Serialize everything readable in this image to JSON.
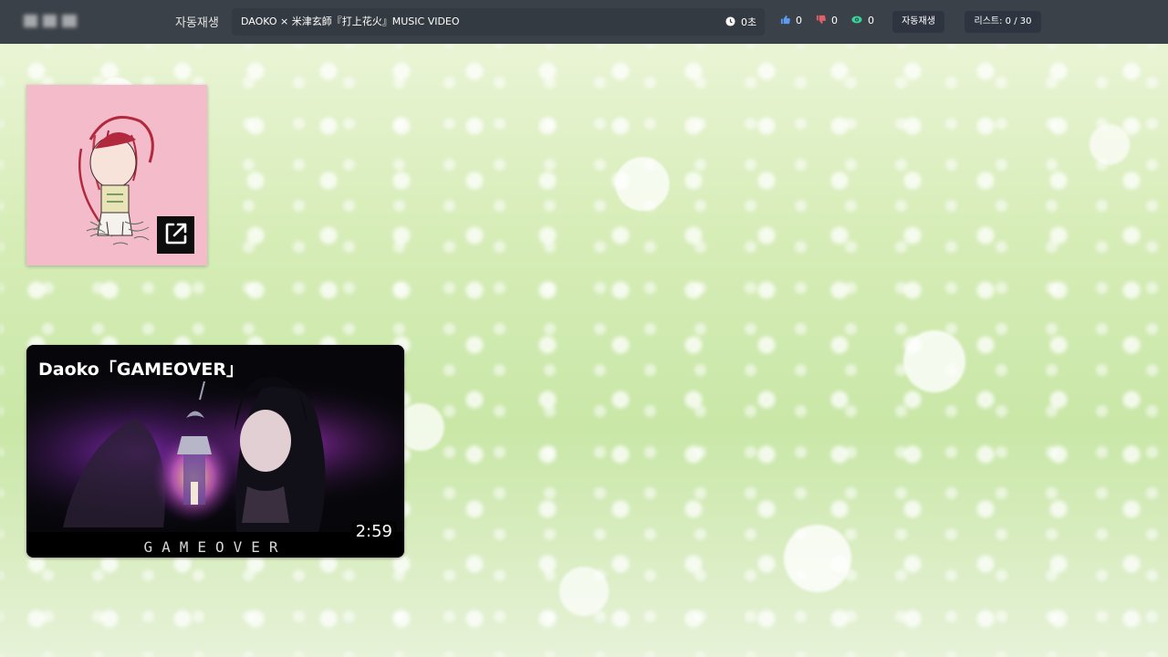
{
  "header": {
    "autoplay_label": "자동재생",
    "now_playing": "DAOKO × 米津玄師『打上花火』MUSIC VIDEO",
    "elapsed": "0초",
    "likes": "0",
    "dislikes": "0",
    "views": "0",
    "autoplay_button": "자동재생",
    "list_button": "리스트: 0 / 30"
  },
  "video": {
    "title": "Daoko「GAMEOVER」",
    "duration": "2:59",
    "caption": "GAMEOVER"
  },
  "colors": {
    "topbar": "#3b4148",
    "album_bg": "#f4bccb",
    "like": "#5b9cf0",
    "dislike": "#e0606a",
    "views": "#37d49b"
  }
}
